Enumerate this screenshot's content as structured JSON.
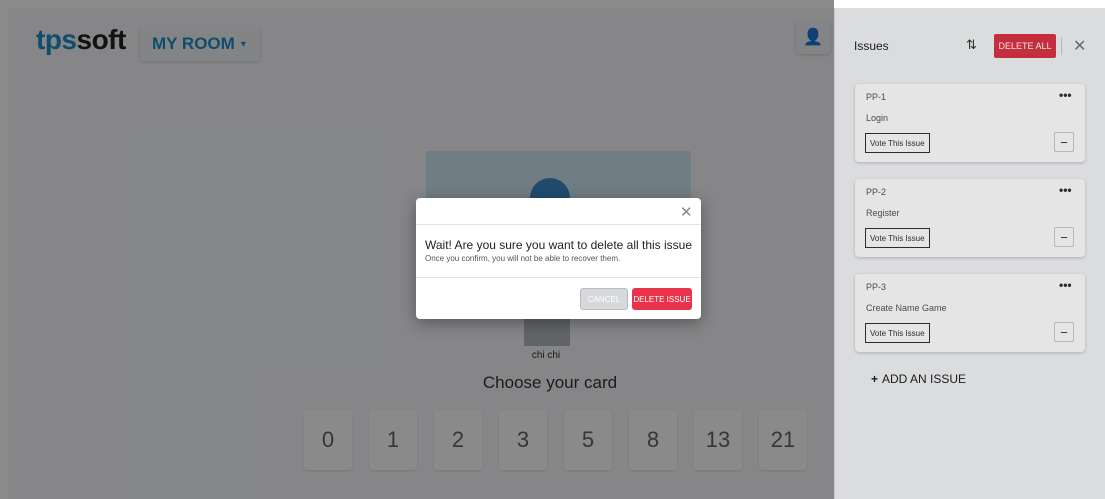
{
  "header": {
    "logo_tps": "tps",
    "logo_soft": "soft",
    "room_label": "MY ROOM",
    "room_caret": "▾",
    "avatar_icon": "👤"
  },
  "main": {
    "player_name": "chi chi",
    "choose_label": "Choose your card",
    "cards": [
      "0",
      "1",
      "2",
      "3",
      "5",
      "8",
      "13",
      "21"
    ]
  },
  "panel": {
    "title": "Issues",
    "swap_icon": "⇅",
    "delete_all_label": "DELETE ALL",
    "close_icon": "✕",
    "issues": [
      {
        "code": "PP-1",
        "name": "Login",
        "vote_label": "Vote This Issue",
        "menu": "•••",
        "minus": "−"
      },
      {
        "code": "PP-2",
        "name": "Register",
        "vote_label": "Vote This Issue",
        "menu": "•••",
        "minus": "−"
      },
      {
        "code": "PP-3",
        "name": "Create Name Game",
        "vote_label": "Vote This Issue",
        "menu": "•••",
        "minus": "−"
      }
    ],
    "add_issue_plus": "+",
    "add_issue_label": "ADD AN ISSUE"
  },
  "modal": {
    "close_icon": "✕",
    "title": "Wait! Are you sure you want to delete all this issue",
    "subtitle": "Once you confirm, you will not be able to recover them.",
    "cancel_label": "CANCEL",
    "delete_label": "DELETE ISSUE"
  },
  "colors": {
    "brand_blue": "#1e8bc3",
    "danger_red": "#dc3545",
    "delete_issue_red": "#e8334a"
  }
}
